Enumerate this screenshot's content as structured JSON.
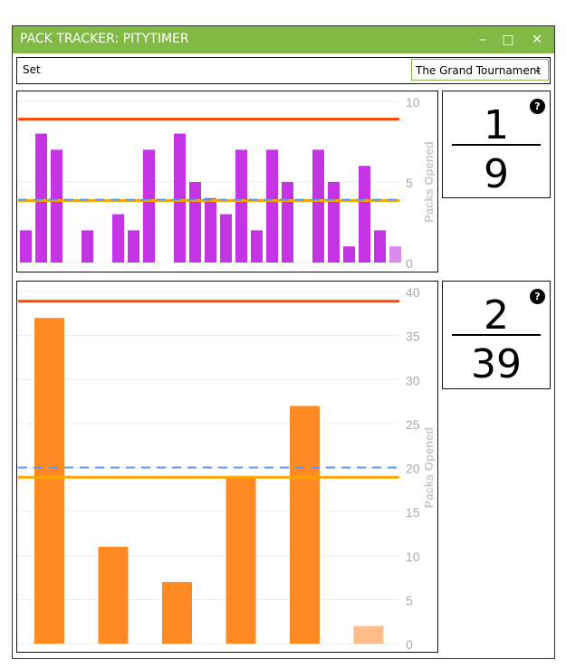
{
  "window": {
    "title": "PACK TRACKER: PITYTIMER",
    "minimize_icon": "minimize-icon",
    "maximize_icon": "maximize-icon",
    "close_icon": "close-icon",
    "titlebar_color": "#82b944"
  },
  "set_row": {
    "label": "Set",
    "selected_set": "The Grand Tournament"
  },
  "panels": [
    {
      "fraction": {
        "numerator": "1",
        "denominator": "9"
      },
      "help_label": "?"
    },
    {
      "fraction": {
        "numerator": "2",
        "denominator": "39"
      },
      "help_label": "?"
    }
  ],
  "chart_data": [
    {
      "type": "bar",
      "ylabel": "Packs Opened",
      "ylim": [
        0,
        10
      ],
      "yticks": [
        "0",
        "5",
        "10"
      ],
      "values": [
        2,
        8,
        7,
        0,
        2,
        0,
        3,
        2,
        7,
        0,
        8,
        5,
        4,
        3,
        7,
        2,
        7,
        5,
        0,
        7,
        5,
        1,
        6,
        2,
        1
      ],
      "last_bar_current": true,
      "bar_color": "#c534e4",
      "current_bar_color": "#da8aee",
      "lines": [
        {
          "value": 8.9,
          "color": "#ff4500",
          "style": "solid"
        },
        {
          "value": 3.85,
          "color": "#ffa500",
          "style": "solid"
        },
        {
          "value": 3.9,
          "color": "#6495ed",
          "style": "dashed"
        }
      ],
      "grid": true
    },
    {
      "type": "bar",
      "ylabel": "Packs Opened",
      "ylim": [
        0,
        40
      ],
      "yticks": [
        "0",
        "5",
        "10",
        "15",
        "20",
        "25",
        "30",
        "35",
        "40"
      ],
      "values": [
        37,
        11,
        7,
        19,
        27,
        2
      ],
      "last_bar_current": true,
      "bar_color": "#ff8a24",
      "current_bar_color": "#ffbb88",
      "lines": [
        {
          "value": 38.9,
          "color": "#ff4500",
          "style": "solid"
        },
        {
          "value": 18.9,
          "color": "#ffa500",
          "style": "solid"
        },
        {
          "value": 20,
          "color": "#6495ed",
          "style": "dashed"
        }
      ],
      "grid": true
    }
  ]
}
